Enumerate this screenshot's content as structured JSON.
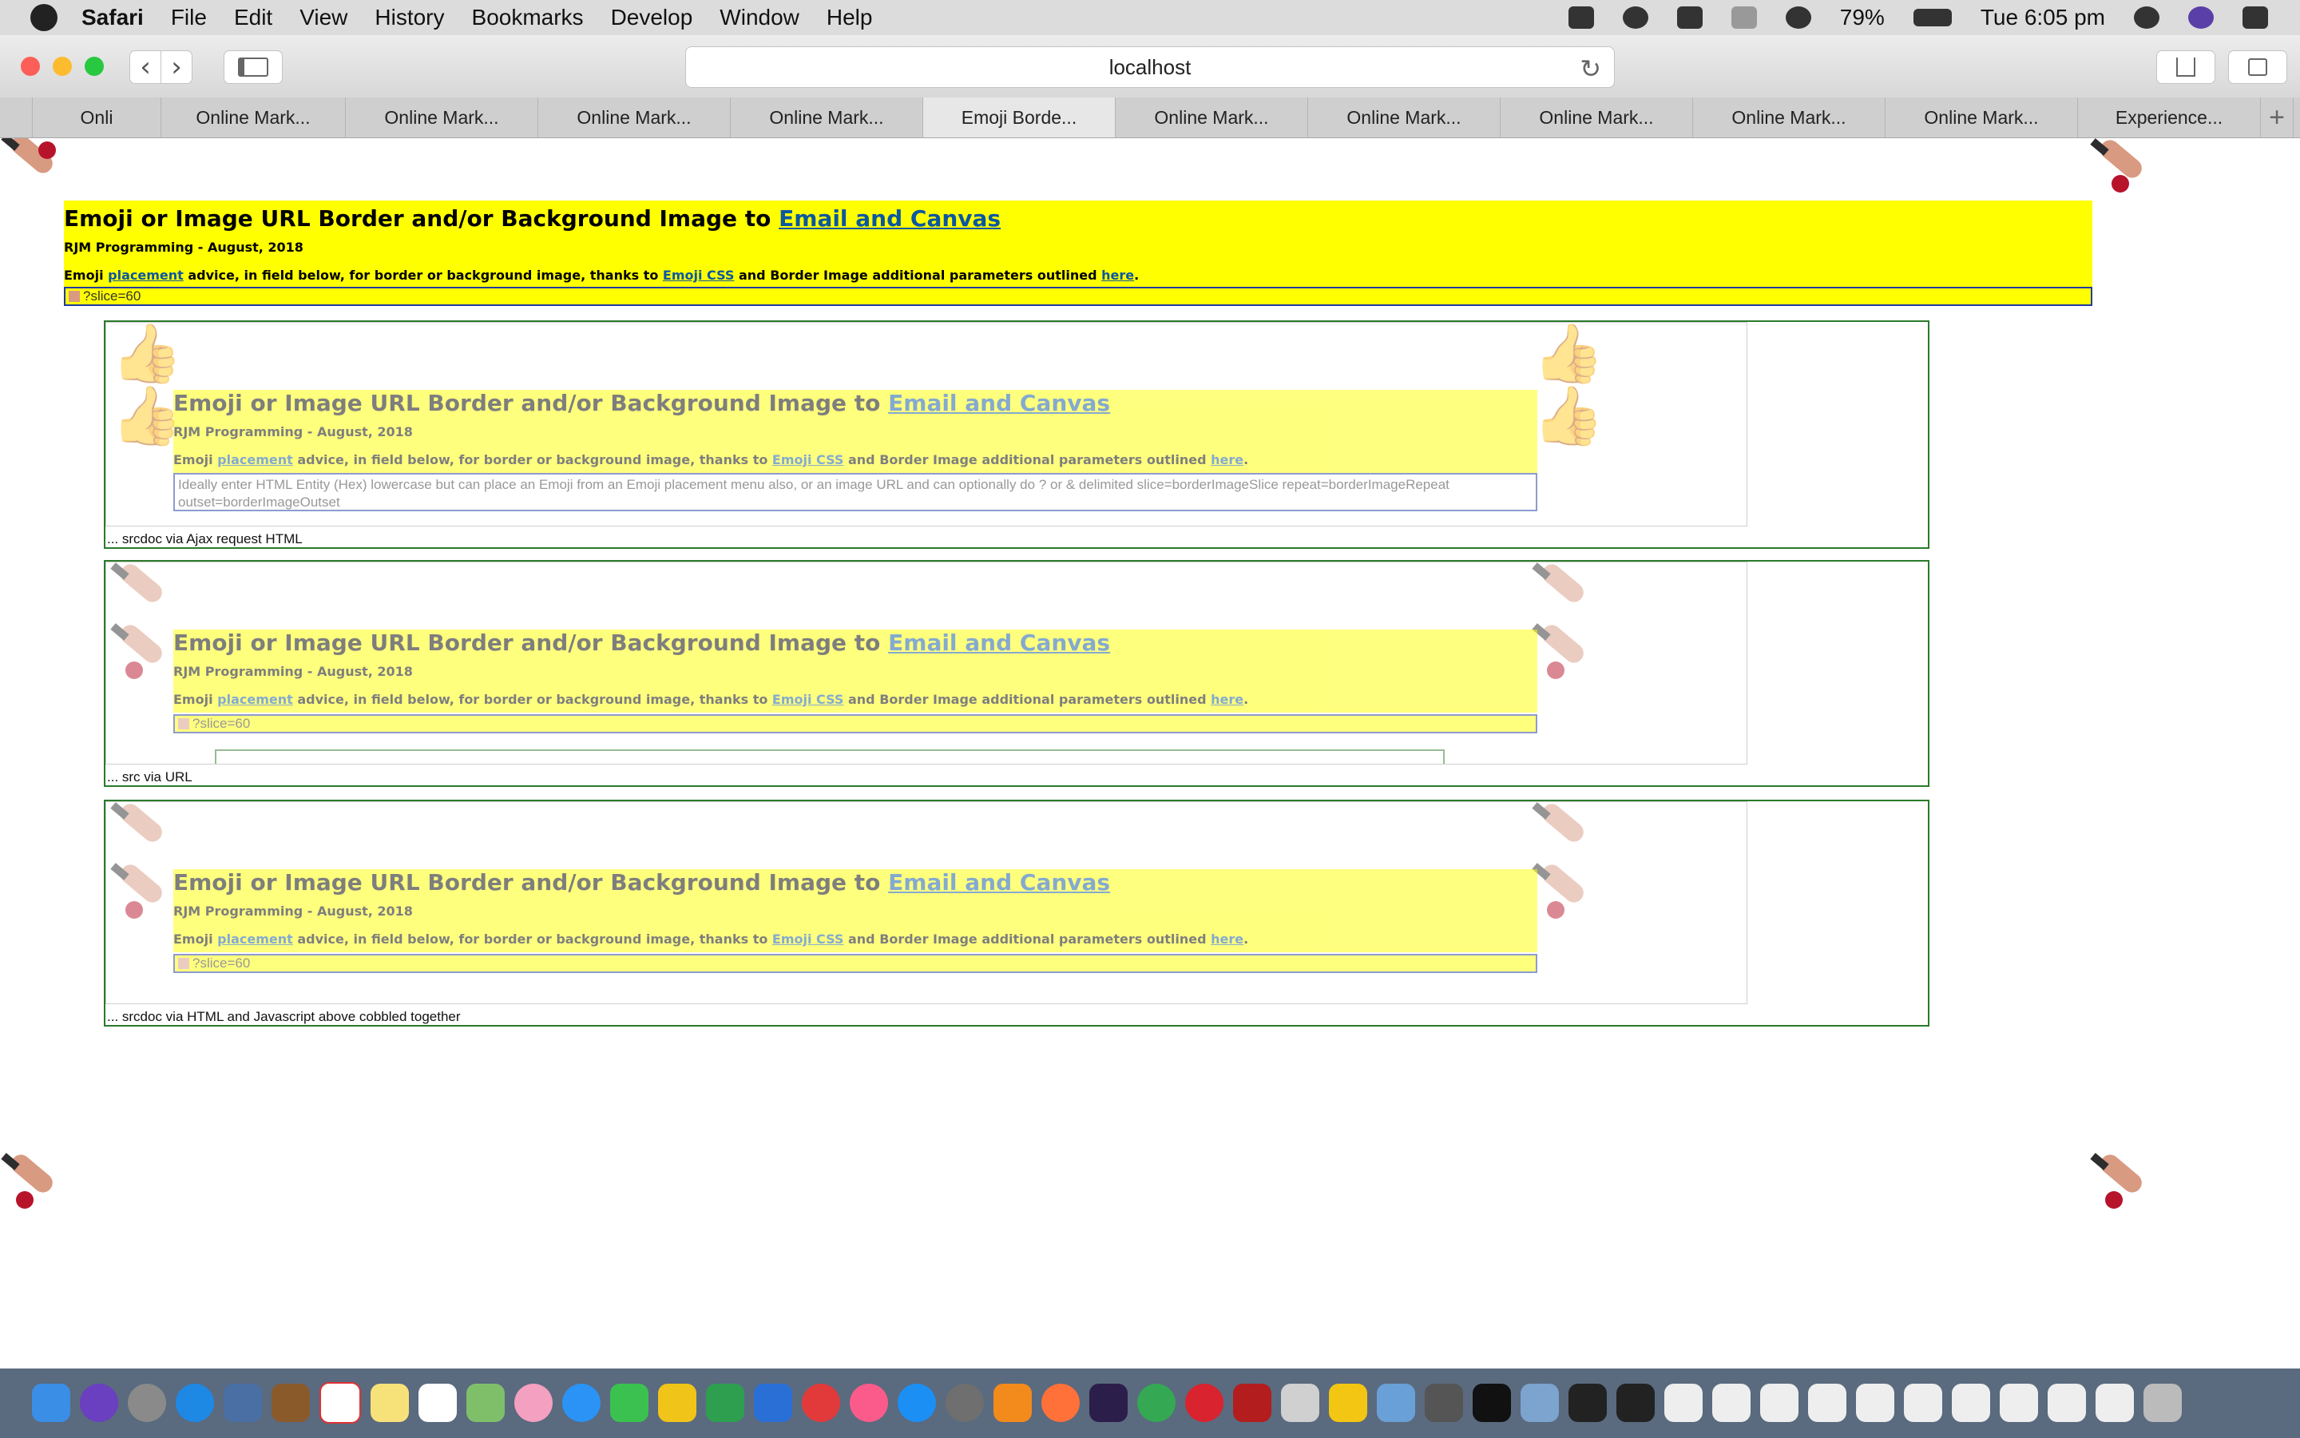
{
  "menubar": {
    "app": "Safari",
    "items": [
      "File",
      "Edit",
      "View",
      "History",
      "Bookmarks",
      "Develop",
      "Window",
      "Help"
    ],
    "battery": "79%",
    "clock": "Tue 6:05 pm"
  },
  "toolbar": {
    "back": "‹",
    "forward": "›",
    "url": "localhost",
    "reload": "↻"
  },
  "tabs": [
    {
      "label": "Onli"
    },
    {
      "label": "Online Mark..."
    },
    {
      "label": "Online Mark..."
    },
    {
      "label": "Online Mark..."
    },
    {
      "label": "Online Mark..."
    },
    {
      "label": "Emoji Borde..."
    },
    {
      "label": "Online Mark..."
    },
    {
      "label": "Online Mark..."
    },
    {
      "label": "Online Mark..."
    },
    {
      "label": "Online Mark..."
    },
    {
      "label": "Online Mark..."
    },
    {
      "label": "Experience..."
    }
  ],
  "new_tab": "+",
  "page": {
    "title_prefix": "Emoji or Image URL Border and/or Background Image to ",
    "title_link": "Email and Canvas",
    "byline": "RJM Programming - August, 2018",
    "para_1": "Emoji ",
    "para_link_1": "placement",
    "para_2": " advice, in field below, for border or background image, thanks to ",
    "para_link_2": "Emoji CSS",
    "para_3": " and Border Image additional parameters outlined ",
    "para_link_3": "here",
    "para_4": ".",
    "input_value": "?slice=60",
    "placeholder_text": "Ideally enter HTML Entity (Hex) lowercase but can place an Emoji from an Emoji placement menu also, or an image URL and can optionally do ? or & delimited slice=borderImageSlice repeat=borderImageRepeat outset=borderImageOutset",
    "captions": {
      "srcdoc_ajax": "... srcdoc via Ajax request HTML",
      "src_url": "... src via URL",
      "srcdoc_js": "... srcdoc via HTML and Javascript above cobbled together"
    }
  },
  "icons": {
    "thumb": "thumbs-up-emoji",
    "cutter": "craft-knife-emoji"
  },
  "colors": {
    "header_bg": "#ffff00",
    "link": "#0b57a0",
    "box_border": "#2b7a2b",
    "input_border": "#203aa0"
  }
}
